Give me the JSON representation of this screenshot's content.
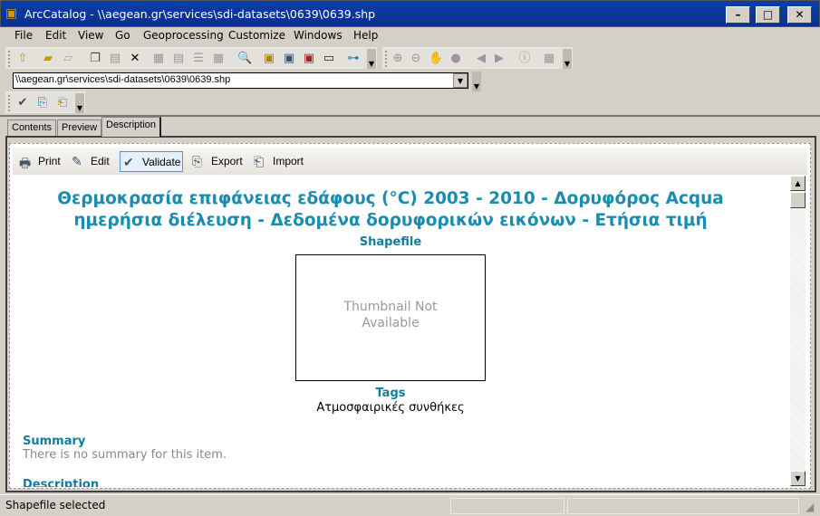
{
  "window": {
    "title": "ArcCatalog - \\\\aegean.gr\\services\\sdi-datasets\\0639\\0639.shp",
    "minimize": "–",
    "maximize": "□",
    "close": "✕"
  },
  "menu": [
    "File",
    "Edit",
    "View",
    "Go",
    "Geoprocessing",
    "Customize",
    "Windows",
    "Help"
  ],
  "location": {
    "value": "\\\\aegean.gr\\services\\sdi-datasets\\0639\\0639.shp"
  },
  "tabs": [
    {
      "label": "Contents"
    },
    {
      "label": "Preview"
    },
    {
      "label": "Description",
      "active": true
    }
  ],
  "desc_toolbar": {
    "print": "Print",
    "edit": "Edit",
    "validate": "Validate",
    "export": "Export",
    "import": "Import"
  },
  "doc": {
    "title_line1": "Θερμοκρασία επιφάνειας εδάφους (°C) 2003 - 2010 - Δορυφόρος Acqua",
    "title_line2": "ημερήσια διέλευση - Δεδομένα δορυφορικών εικόνων - Ετήσια τιμή",
    "type": "Shapefile",
    "thumbnail": "Thumbnail Not Available",
    "tags_label": "Tags",
    "tags": "Ατμοσφαιρικές συνθήκες",
    "summary_label": "Summary",
    "summary": "There is no summary for this item.",
    "description_label": "Description"
  },
  "status": {
    "text": "Shapefile selected"
  },
  "colors": {
    "titlebar": "#0a3fa6",
    "heading": "#1a8cb0"
  }
}
